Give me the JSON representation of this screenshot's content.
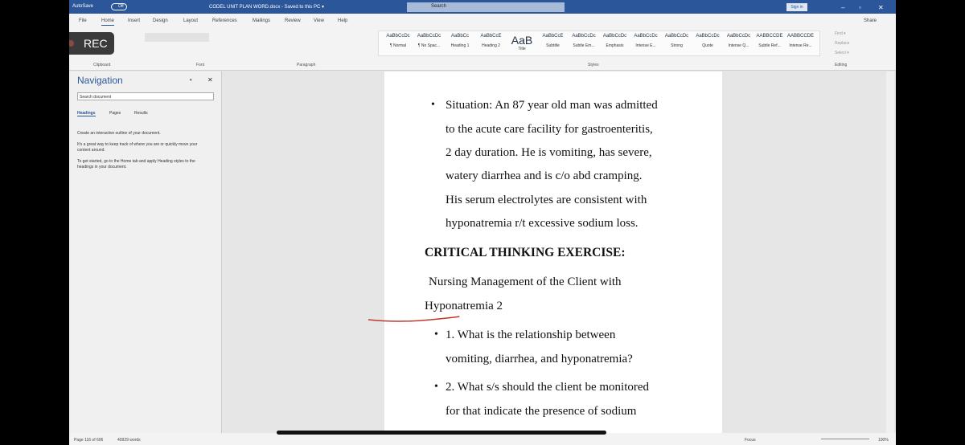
{
  "titlebar": {
    "autosave": "AutoSave",
    "toggle": "Off",
    "doc_title": "CODEL UNIT PLAN WORD.docx  -  Saved to this PC  ▾",
    "search": "Search",
    "signin": "Sign in"
  },
  "tabs": [
    "File",
    "Home",
    "Insert",
    "Design",
    "Layout",
    "References",
    "Mailings",
    "Review",
    "View",
    "Help"
  ],
  "share": "Share",
  "ribbon": {
    "groups": [
      "Clipboard",
      "Font",
      "Paragraph",
      "Styles",
      "Editing"
    ],
    "format_painter": "Format Painter",
    "styles": [
      {
        "preview": "AaBbCcDc",
        "name": "¶ Normal"
      },
      {
        "preview": "AaBbCcDc",
        "name": "¶ No Spac..."
      },
      {
        "preview": "AaBbCc",
        "name": "Heading 1"
      },
      {
        "preview": "AaBbCcE",
        "name": "Heading 2"
      },
      {
        "preview": "AaB",
        "name": "Title"
      },
      {
        "preview": "AaBbCcE",
        "name": "Subtitle"
      },
      {
        "preview": "AaBbCcDc",
        "name": "Subtle Em..."
      },
      {
        "preview": "AaBbCcDc",
        "name": "Emphasis"
      },
      {
        "preview": "AaBbCcDc",
        "name": "Intense E..."
      },
      {
        "preview": "AaBbCcDc",
        "name": "Strong"
      },
      {
        "preview": "AaBbCcDc",
        "name": "Quote"
      },
      {
        "preview": "AaBbCcDc",
        "name": "Intense Q..."
      },
      {
        "preview": "AABBCCDE",
        "name": "Subtle Ref..."
      },
      {
        "preview": "AABBCCDE",
        "name": "Intense Re..."
      }
    ],
    "editing": [
      "Find ▾",
      "Replace",
      "Select ▾"
    ]
  },
  "rec": "REC",
  "navigation": {
    "title": "Navigation",
    "search_placeholder": "Search document",
    "tabs": [
      "Headings",
      "Pages",
      "Results"
    ],
    "help": [
      "Create an interactive outline of your document.",
      "It's a great way to keep track of where you are or quickly move your content around.",
      "To get started, go to the Home tab and apply Heading styles to the headings in your document."
    ]
  },
  "document": {
    "lines": [
      "Situation: An 87 year old man was admitted",
      "to the acute care facility for gastroenteritis,",
      "2 day duration. He is vomiting, has severe,",
      "watery diarrhea and is c/o abd cramping.",
      "His serum electrolytes are consistent with",
      "hyponatremia r/t excessive sodium loss."
    ],
    "heading": "CRITICAL THINKING EXERCISE:",
    "sub1": "Nursing  Management  of  the  Client  with",
    "sub2": "Hyponatremia 2",
    "q1a": "1.  What  is  the  relationship  between",
    "q1b": "vomiting, diarrhea, and hyponatremia?",
    "q2a": "2. What s/s should the client be monitored",
    "q2b": "for  that  indicate  the  presence  of  sodium"
  },
  "status": {
    "page": "Page 116 of 606",
    "words": "40929 words",
    "focus": "Focus",
    "zoom": "100%"
  },
  "colors": {
    "brand": "#2b579a",
    "annotation": "#c0392b"
  }
}
